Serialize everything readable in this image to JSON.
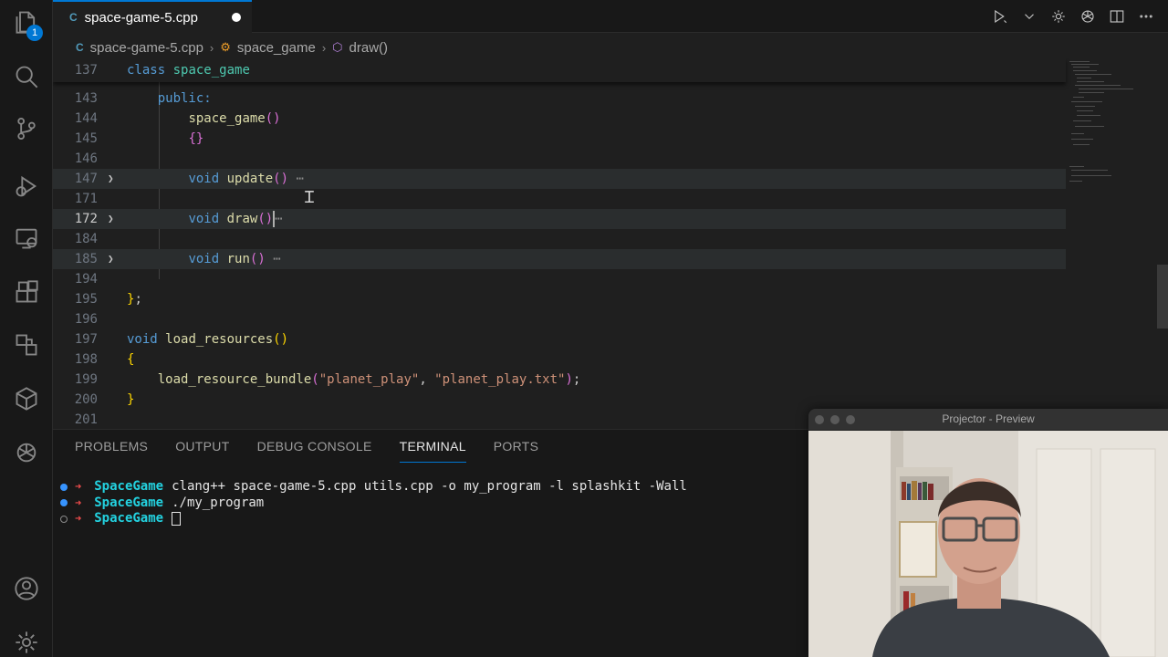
{
  "activity_bar": {
    "explorer_badge": "1",
    "items": [
      "explorer-icon",
      "search-icon",
      "source-control-icon",
      "run-debug-icon",
      "remote-explorer-icon",
      "extensions-icon",
      "testing-icon",
      "containers-icon",
      "chatgpt-icon"
    ],
    "bottom": [
      "account-icon",
      "settings-icon"
    ]
  },
  "tab": {
    "c_badge": "C",
    "label": "space-game-5.cpp"
  },
  "breadcrumb": {
    "c_badge": "C",
    "file": "space-game-5.cpp",
    "class": "space_game",
    "method": "draw()"
  },
  "editor": {
    "sticky": {
      "num": "137",
      "kw": "class",
      "name": "space_game"
    },
    "lines": [
      {
        "num": "143"
      },
      {
        "num": "144"
      },
      {
        "num": "145"
      },
      {
        "num": "146"
      },
      {
        "num": "147"
      },
      {
        "num": "171"
      },
      {
        "num": "172"
      },
      {
        "num": "184"
      },
      {
        "num": "185"
      },
      {
        "num": "194"
      },
      {
        "num": "195"
      },
      {
        "num": "196"
      },
      {
        "num": "197"
      },
      {
        "num": "198"
      },
      {
        "num": "199"
      },
      {
        "num": "200"
      },
      {
        "num": "201"
      }
    ],
    "tokens": {
      "public": "public:",
      "ctor": "space_game",
      "void": "void",
      "update": "update",
      "draw": "draw",
      "run": "run",
      "load_resources": "load_resources",
      "load_bundle": "load_resource_bundle",
      "arg1": "\"planet_play\"",
      "arg2": "\"planet_play.txt\"",
      "ellipsis": "⋯"
    }
  },
  "panel": {
    "tabs": [
      "PROBLEMS",
      "OUTPUT",
      "DEBUG CONSOLE",
      "TERMINAL",
      "PORTS"
    ],
    "active_tab": "TERMINAL",
    "terminal": [
      {
        "dir": "SpaceGame",
        "cmd": "clang++ space-game-5.cpp utils.cpp -o my_program -l splashkit -Wall"
      },
      {
        "dir": "SpaceGame",
        "cmd": "./my_program"
      },
      {
        "dir": "SpaceGame",
        "cmd": ""
      }
    ]
  },
  "projector": {
    "title": "Projector - Preview"
  },
  "colors": {
    "accent": "#0078d4",
    "keyword": "#569cd6",
    "function": "#dcdcaa",
    "type": "#4ec9b0",
    "string": "#ce9178",
    "terminal_dir": "#23d2e0"
  }
}
